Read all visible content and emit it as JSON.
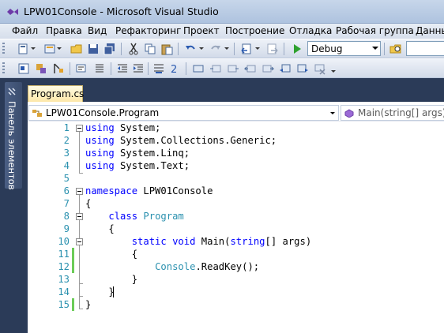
{
  "window": {
    "title": "LPW01Console - Microsoft Visual Studio"
  },
  "menu": [
    "Файл",
    "Правка",
    "Вид",
    "Рефакторинг",
    "Проект",
    "Построение",
    "Отладка",
    "Рабочая группа",
    "Данны"
  ],
  "toolbar": {
    "configuration": "Debug",
    "icons": [
      "new-project-icon",
      "add-item-icon",
      "open-file-icon",
      "save-icon",
      "save-all-icon",
      "cut-icon",
      "copy-icon",
      "paste-icon",
      "undo-icon",
      "redo-icon",
      "navigate-back-icon",
      "navigate-forward-icon",
      "start-debugging-icon",
      "find-in-files-icon"
    ],
    "text_editor_icons": [
      "class-view-icon",
      "object-browser-icon",
      "properties-icon",
      "decrease-indent-icon",
      "increase-indent-icon",
      "comment-icon",
      "uncomment-icon",
      "bookmark-icon",
      "prev-bookmark-icon",
      "next-bookmark-icon",
      "prev-bookmark-folder-icon",
      "next-bookmark-folder-icon",
      "clear-bookmarks-icon"
    ]
  },
  "side_panel": {
    "label": "Панель элементов"
  },
  "tab": {
    "label": "Program.cs"
  },
  "navigation": {
    "type_label": "LPW01Console.Program",
    "member_label": "Main(string[] args)"
  },
  "code": {
    "lines": [
      {
        "num": "1",
        "changed": false,
        "tokens": [
          {
            "t": "kw",
            "v": "using"
          },
          {
            "t": "tx",
            "v": " System;"
          }
        ]
      },
      {
        "num": "2",
        "changed": false,
        "tokens": [
          {
            "t": "kw",
            "v": "using"
          },
          {
            "t": "tx",
            "v": " System.Collections.Generic;"
          }
        ]
      },
      {
        "num": "3",
        "changed": false,
        "tokens": [
          {
            "t": "kw",
            "v": "using"
          },
          {
            "t": "tx",
            "v": " System.Linq;"
          }
        ]
      },
      {
        "num": "4",
        "changed": false,
        "tokens": [
          {
            "t": "kw",
            "v": "using"
          },
          {
            "t": "tx",
            "v": " System.Text;"
          }
        ]
      },
      {
        "num": "5",
        "changed": false,
        "tokens": []
      },
      {
        "num": "6",
        "changed": false,
        "tokens": [
          {
            "t": "kw",
            "v": "namespace"
          },
          {
            "t": "tx",
            "v": " LPW01Console"
          }
        ]
      },
      {
        "num": "7",
        "changed": false,
        "tokens": [
          {
            "t": "tx",
            "v": "{"
          }
        ]
      },
      {
        "num": "8",
        "changed": false,
        "tokens": [
          {
            "t": "tx",
            "v": "    "
          },
          {
            "t": "kw",
            "v": "class"
          },
          {
            "t": "tx",
            "v": " "
          },
          {
            "t": "ty",
            "v": "Program"
          }
        ]
      },
      {
        "num": "9",
        "changed": false,
        "tokens": [
          {
            "t": "tx",
            "v": "    {"
          }
        ]
      },
      {
        "num": "10",
        "changed": false,
        "tokens": [
          {
            "t": "tx",
            "v": "        "
          },
          {
            "t": "kw",
            "v": "static"
          },
          {
            "t": "tx",
            "v": " "
          },
          {
            "t": "kw",
            "v": "void"
          },
          {
            "t": "tx",
            "v": " Main("
          },
          {
            "t": "kw",
            "v": "string"
          },
          {
            "t": "tx",
            "v": "[] args)"
          }
        ]
      },
      {
        "num": "11",
        "changed": true,
        "tokens": [
          {
            "t": "tx",
            "v": "        {"
          }
        ]
      },
      {
        "num": "12",
        "changed": true,
        "tokens": [
          {
            "t": "tx",
            "v": "            "
          },
          {
            "t": "ty",
            "v": "Console"
          },
          {
            "t": "tx",
            "v": ".ReadKey();"
          }
        ]
      },
      {
        "num": "13",
        "changed": false,
        "tokens": [
          {
            "t": "tx",
            "v": "        }"
          }
        ]
      },
      {
        "num": "14",
        "changed": false,
        "tokens": [
          {
            "t": "tx",
            "v": "    }"
          }
        ]
      },
      {
        "num": "15",
        "changed": true,
        "tokens": [
          {
            "t": "tx",
            "v": "}"
          }
        ]
      }
    ]
  },
  "colors": {
    "keyword": "#0000ff",
    "type": "#2b91af",
    "line_number": "#2b91af",
    "change_marker": "#6ccc58",
    "background": "#2b3b58"
  }
}
